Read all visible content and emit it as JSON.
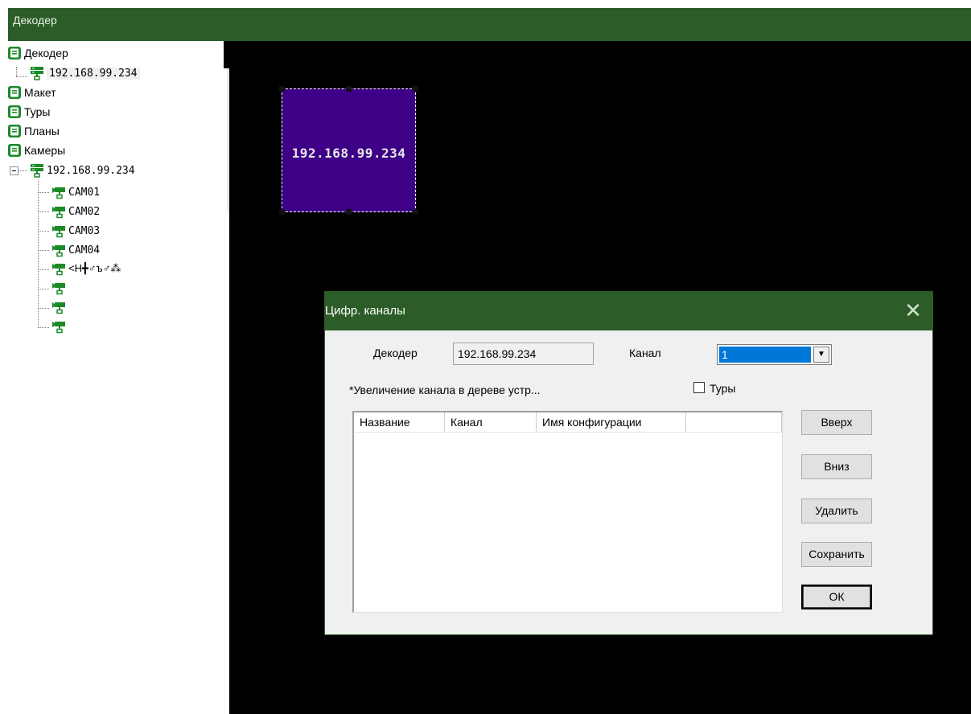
{
  "app": {
    "title": "Декодер"
  },
  "tree": {
    "nodes": [
      {
        "label": "Декодер",
        "icon": "group-icon"
      },
      {
        "label": "192.168.99.234",
        "icon": "decoder-device-icon",
        "selected": true
      },
      {
        "label": "Макет",
        "icon": "group-icon"
      },
      {
        "label": "Туры",
        "icon": "group-icon"
      },
      {
        "label": "Планы",
        "icon": "group-icon"
      },
      {
        "label": "Камеры",
        "icon": "group-icon"
      },
      {
        "label": "192.168.99.234",
        "icon": "decoder-device-icon"
      },
      {
        "label": "CAM01",
        "icon": "camera-icon"
      },
      {
        "label": "CAM02",
        "icon": "camera-icon"
      },
      {
        "label": "CAM03",
        "icon": "camera-icon"
      },
      {
        "label": "CAM04",
        "icon": "camera-icon"
      },
      {
        "label": "<H╋♂ъ♂⁂",
        "icon": "camera-icon"
      },
      {
        "label": "",
        "icon": "camera-icon"
      },
      {
        "label": "",
        "icon": "camera-icon"
      },
      {
        "label": "",
        "icon": "camera-icon"
      }
    ]
  },
  "canvas": {
    "tile_label": "192.168.99.234",
    "tile_color": "#3d0087"
  },
  "dialog": {
    "title": "Цифр. каналы",
    "decoder_label": "Декодер",
    "decoder_value": "192.168.99.234",
    "channel_label": "Канал",
    "channel_value": "1",
    "note": "*Увеличение канала в дереве устр...",
    "tours_label": "Туры",
    "tours_checked": false,
    "columns": [
      "Название",
      "Канал",
      "Имя конфигурации",
      ""
    ],
    "buttons": {
      "up": "Вверх",
      "down": "Вниз",
      "delete": "Удалить",
      "save": "Сохранить",
      "ok": "ОК"
    }
  },
  "colors": {
    "accent_green": "#2c5c28",
    "icon_green": "#1d8a2a",
    "selection_blue": "#0078d7"
  }
}
